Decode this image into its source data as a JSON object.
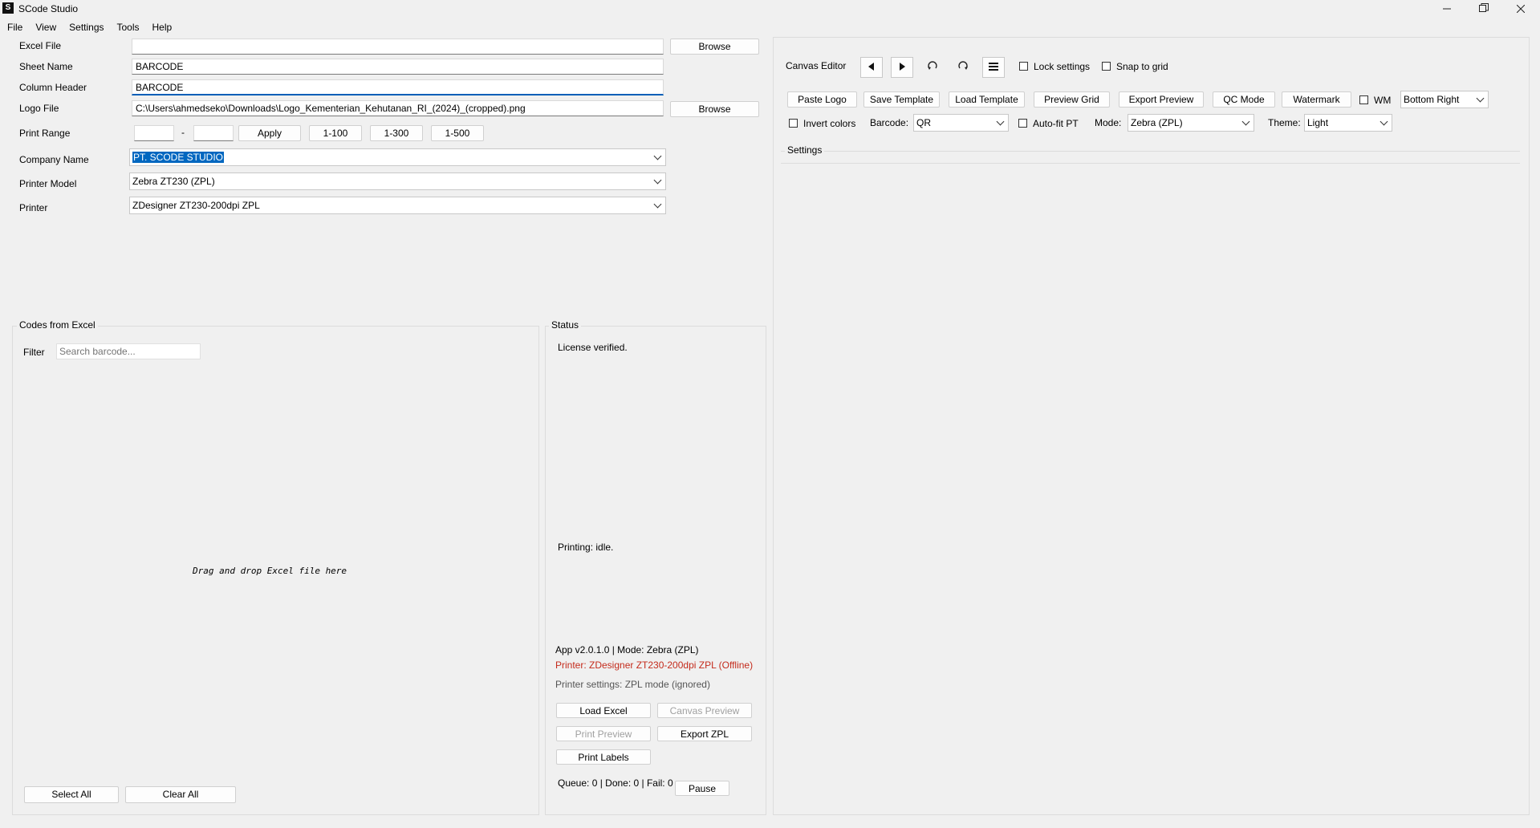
{
  "window": {
    "title": "SCode Studio",
    "app_icon_glyph": "S",
    "controls": [
      "minimize",
      "maximize",
      "close"
    ]
  },
  "menubar": {
    "items": [
      "File",
      "View",
      "Settings",
      "Tools",
      "Help"
    ]
  },
  "form": {
    "excel_file": {
      "label": "Excel File",
      "value": "",
      "browse_label": "Browse"
    },
    "sheet_name": {
      "label": "Sheet Name",
      "value": "BARCODE"
    },
    "column_header": {
      "label": "Column Header",
      "value": "BARCODE"
    },
    "logo_file": {
      "label": "Logo File",
      "value": "C:\\Users\\ahmedseko\\Downloads\\Logo_Kementerian_Kehutanan_RI_(2024)_(cropped).png",
      "browse_label": "Browse"
    },
    "print_range": {
      "label": "Print Range",
      "from": "",
      "separator": "-",
      "to": "",
      "apply_label": "Apply",
      "presets": [
        "1-100",
        "1-300",
        "1-500"
      ]
    },
    "company_name": {
      "label": "Company Name",
      "value": "PT. SCODE STUDIO"
    },
    "printer_model": {
      "label": "Printer Model",
      "value": "Zebra ZT230 (ZPL)"
    },
    "printer": {
      "label": "Printer",
      "value": "ZDesigner ZT230-200dpi ZPL"
    }
  },
  "codes_panel": {
    "title": "Codes from Excel",
    "filter_label": "Filter",
    "search_placeholder": "Search barcode...",
    "drop_hint": "Drag and drop Excel file here",
    "select_all_label": "Select All",
    "clear_all_label": "Clear All"
  },
  "status_panel": {
    "title": "Status",
    "license": "License verified.",
    "printing": "Printing: idle.",
    "app_info": "App v2.0.1.0 | Mode: Zebra (ZPL)",
    "printer_status": "Printer: ZDesigner ZT230-200dpi ZPL (Offline)",
    "printer_settings": "Printer settings: ZPL mode (ignored)",
    "buttons": {
      "load_excel": "Load Excel",
      "canvas_preview": "Canvas Preview",
      "print_preview": "Print Preview",
      "export_zpl": "Export ZPL",
      "print_labels": "Print Labels",
      "pause": "Pause"
    },
    "queue_info": "Queue: 0 | Done: 0 | Fail: 0"
  },
  "canvas_editor": {
    "title": "Canvas Editor",
    "tools": [
      "prev-icon",
      "next-icon",
      "rotate-left-icon",
      "rotate-right-icon",
      "menu-icon"
    ],
    "lock_settings_label": "Lock settings",
    "snap_to_grid_label": "Snap to grid",
    "buttons": {
      "paste_logo": "Paste Logo",
      "save_template": "Save Template",
      "load_template": "Load Template",
      "preview_grid": "Preview Grid",
      "export_preview": "Export Preview",
      "qc_mode": "QC Mode",
      "watermark": "Watermark"
    },
    "wm_label": "WM",
    "wm_position": "Bottom Right",
    "invert_colors_label": "Invert colors",
    "barcode_label": "Barcode:",
    "barcode_value": "QR",
    "autofit_label": "Auto-fit PT",
    "mode_label": "Mode:",
    "mode_value": "Zebra (ZPL)",
    "theme_label": "Theme:",
    "theme_value": "Light",
    "settings_title": "Settings"
  },
  "colors": {
    "background": "#f0f0f0",
    "selection": "#0067c0",
    "focus_underline": "#005fb8",
    "offline_red": "#c42b1c",
    "muted_text": "#555555"
  }
}
